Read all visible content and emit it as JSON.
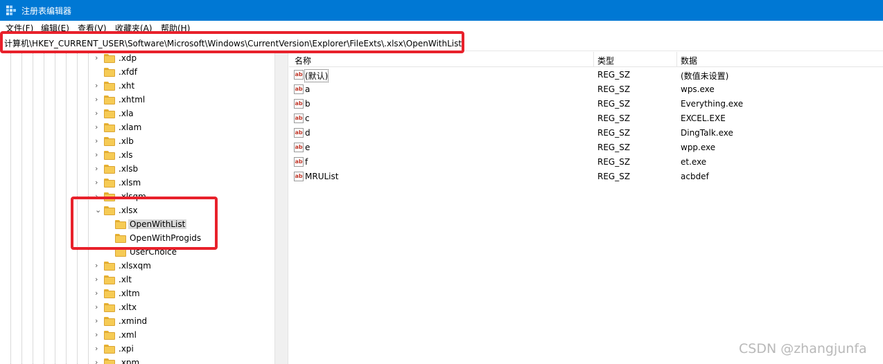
{
  "window": {
    "title": "注册表编辑器",
    "accent": "#0078d4"
  },
  "menu": [
    "文件(F)",
    "编辑(E)",
    "查看(V)",
    "收藏夹(A)",
    "帮助(H)"
  ],
  "address": "计算机\\HKEY_CURRENT_USER\\Software\\Microsoft\\Windows\\CurrentVersion\\Explorer\\FileExts\\.xlsx\\OpenWithList",
  "highlight_color": "#e8212b",
  "tree": {
    "items": [
      {
        "label": ".xdp",
        "expanded": false
      },
      {
        "label": ".xfdf",
        "expanded": false
      },
      {
        "label": ".xht",
        "expanded": false
      },
      {
        "label": ".xhtml",
        "expanded": false
      },
      {
        "label": ".xla",
        "expanded": false
      },
      {
        "label": ".xlam",
        "expanded": false
      },
      {
        "label": ".xlb",
        "expanded": false
      },
      {
        "label": ".xls",
        "expanded": false
      },
      {
        "label": ".xlsb",
        "expanded": false
      },
      {
        "label": ".xlsm",
        "expanded": false
      },
      {
        "label": ".xlsqm",
        "expanded": false
      },
      {
        "label": ".xlsx",
        "expanded": true
      },
      {
        "label": "OpenWithList",
        "selected": true
      },
      {
        "label": "OpenWithProgids"
      },
      {
        "label": "UserChoice"
      },
      {
        "label": ".xlsxqm",
        "expanded": false
      },
      {
        "label": ".xlt",
        "expanded": false
      },
      {
        "label": ".xltm",
        "expanded": false
      },
      {
        "label": ".xltx",
        "expanded": false
      },
      {
        "label": ".xmind",
        "expanded": false
      },
      {
        "label": ".xml",
        "expanded": false
      },
      {
        "label": ".xpi",
        "expanded": false
      },
      {
        "label": ".xpm",
        "expanded": false
      }
    ]
  },
  "list": {
    "columns": [
      "名称",
      "类型",
      "数据"
    ],
    "rows": [
      {
        "name": "(默认)",
        "type": "REG_SZ",
        "data": "(数值未设置)"
      },
      {
        "name": "a",
        "type": "REG_SZ",
        "data": "wps.exe"
      },
      {
        "name": "b",
        "type": "REG_SZ",
        "data": "Everything.exe"
      },
      {
        "name": "c",
        "type": "REG_SZ",
        "data": "EXCEL.EXE"
      },
      {
        "name": "d",
        "type": "REG_SZ",
        "data": "DingTalk.exe"
      },
      {
        "name": "e",
        "type": "REG_SZ",
        "data": "wpp.exe"
      },
      {
        "name": "f",
        "type": "REG_SZ",
        "data": "et.exe"
      },
      {
        "name": "MRUList",
        "type": "REG_SZ",
        "data": "acbdef"
      }
    ],
    "value_icon": "ab"
  },
  "watermark": "CSDN @zhangjunfa"
}
